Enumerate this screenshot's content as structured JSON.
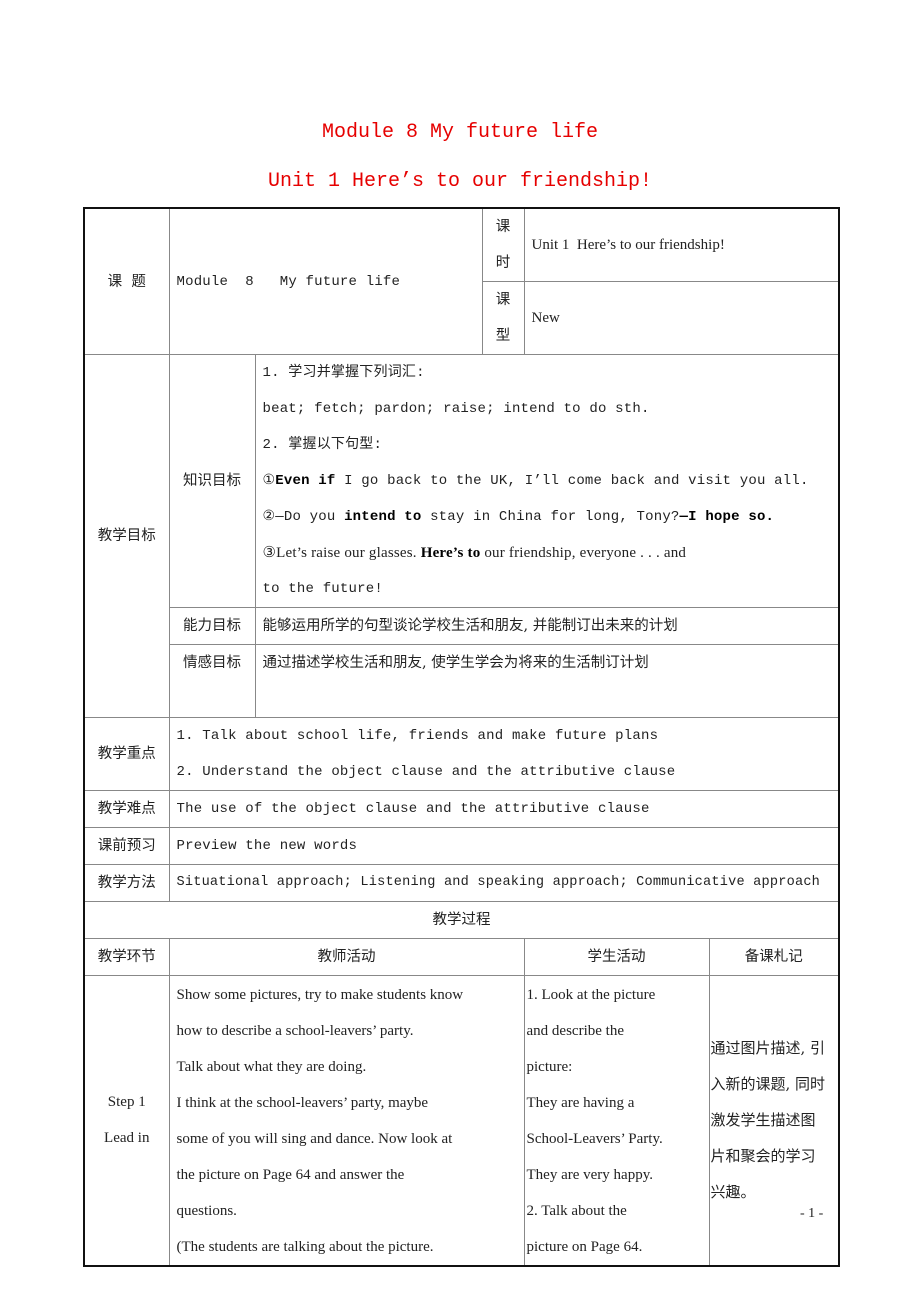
{
  "titles": {
    "module": "Module 8   My future life",
    "unit": "Unit 1  Here’s to our friendship!"
  },
  "header": {
    "topic_label": "课  题",
    "topic_value": "Module  8   My future life",
    "period_label": "课时",
    "period_value": "Unit 1  Here’s to our friendship!",
    "type_label": "课型",
    "type_value": "New"
  },
  "objectives": {
    "label": "教学目标",
    "knowledge": {
      "label": "知识目标",
      "line1": "1. 学习并掌握下列词汇:",
      "line2": "beat; fetch; pardon; raise; intend to do sth.",
      "line3": "2. 掌握以下句型:",
      "s1_prefix": "①",
      "s1_bold": "Even if",
      "s1_rest": " I go back to the UK, I’ll come back and visit you all.",
      "s2_prefix": "②—Do you ",
      "s2_bold1": "intend to",
      "s2_mid": " stay in China for long, Tony?",
      "s2_bold2": "—I hope so.",
      "s3_prefix": "③Let’s raise our glasses. ",
      "s3_bold": "Here’s to",
      "s3_rest": " our friendship, everyone . . . and",
      "s3_cont": "to the future!"
    },
    "ability": {
      "label": "能力目标",
      "text": "能够运用所学的句型谈论学校生活和朋友, 并能制订出未来的计划"
    },
    "emotion": {
      "label": "情感目标",
      "text": "通过描述学校生活和朋友, 使学生学会为将来的生活制订计划"
    }
  },
  "key_points": {
    "label": "教学重点",
    "items": [
      "1. Talk about school life, friends and make future plans",
      "2. Understand the object clause and the attributive clause"
    ]
  },
  "difficulties": {
    "label": "教学难点",
    "text": "The use of the object clause and the attributive clause"
  },
  "preview": {
    "label": "课前预习",
    "text": "Preview the new words"
  },
  "methods": {
    "label": "教学方法",
    "text": "Situational approach; Listening and speaking approach; Communicative approach"
  },
  "process": {
    "title": "教学过程",
    "columns": [
      "教学环节",
      "教师活动",
      "学生活动",
      "备课札记"
    ],
    "step1": {
      "step": [
        "Step 1",
        "Lead in"
      ],
      "teacher": [
        "Show some pictures, try to make students know",
        "how to describe a school-leavers’ party.",
        "Talk about what they are doing.",
        "I think at the school-leavers’ party, maybe",
        "some of you will sing and dance. Now look at",
        "the picture on Page 64 and answer the",
        "questions.",
        "(The students are talking about the picture."
      ],
      "student": [
        "1. Look at the picture",
        "and describe the",
        "picture:",
        "They are having a",
        "School-Leavers’ Party.",
        "They are very happy.",
        "2. Talk about the",
        "picture on Page 64."
      ],
      "notes": [
        "通过图片描述, 引",
        "入新的课题, 同时",
        "激发学生描述图",
        "片和聚会的学习",
        "兴趣。"
      ]
    }
  },
  "page_number": "- 1 -"
}
